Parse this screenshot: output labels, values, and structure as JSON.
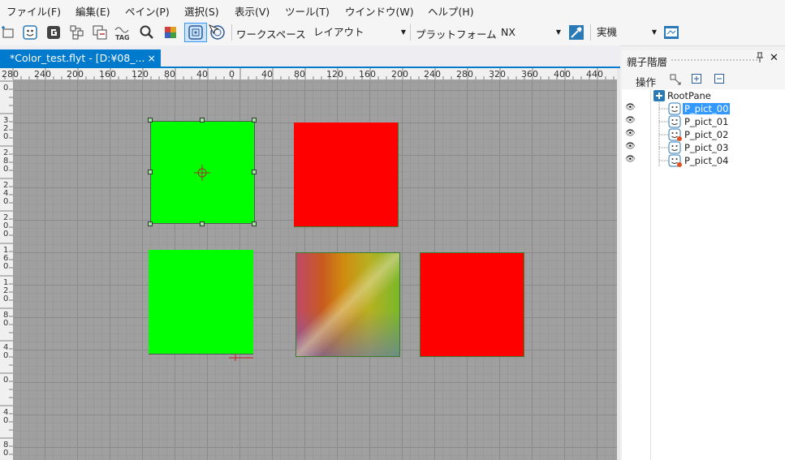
{
  "menu": {
    "items": [
      "ファイル(F)",
      "編集(E)",
      "ペイン(P)",
      "選択(S)",
      "表示(V)",
      "ツール(T)",
      "ウインドウ(W)",
      "ヘルプ(H)"
    ]
  },
  "toolbar": {
    "workspace_label": "ワークスペース",
    "workspace_value": "レイアウト",
    "platform_label": "プラットフォーム",
    "platform_value": "NX",
    "target_value": "実機",
    "icons": [
      "add-pane-icon",
      "picture-pane-icon",
      "group-icon",
      "hierarchy-icon",
      "copy-pane-icon",
      "tag-icon",
      "search-icon",
      "color-grid-icon",
      "select-mode-icon",
      "multi-select-icon",
      "eyedropper-icon",
      "preview-icon"
    ]
  },
  "document": {
    "tab_title": "*Color_test.flyt - [D:¥08_...",
    "close": "×"
  },
  "ruler": {
    "h_labels": [
      "280",
      "240",
      "200",
      "160",
      "120",
      "80",
      "40",
      "0",
      "40",
      "80",
      "120",
      "160",
      "200",
      "240",
      "280",
      "320",
      "360",
      "400",
      "440"
    ],
    "v_labels": [
      "0",
      "3\n2\n0",
      "2\n8\n0",
      "2\n4\n0",
      "2\n0\n0",
      "1\n6\n0",
      "1\n2\n0",
      "8\n0",
      "4\n0",
      "0",
      "4\n0",
      "8\n0"
    ]
  },
  "canvas": {
    "panes": [
      {
        "name": "P_pict_00",
        "color": "#00ff00",
        "selected": true
      },
      {
        "name": "P_pict_01",
        "color": "#ff0000"
      },
      {
        "name": "P_pict_02",
        "color": "#00ff00"
      },
      {
        "name": "P_pict_03",
        "color": "gradient"
      },
      {
        "name": "P_pict_04",
        "color": "#ff0000"
      }
    ]
  },
  "hierarchy_panel": {
    "title": "親子階層",
    "pin": "📌",
    "close": "✕",
    "operation_label": "操作",
    "root": "RootPane",
    "children": [
      "P_pict_00",
      "P_pict_01",
      "P_pict_02",
      "P_pict_03",
      "P_pict_04"
    ],
    "selected": "P_pict_00"
  }
}
